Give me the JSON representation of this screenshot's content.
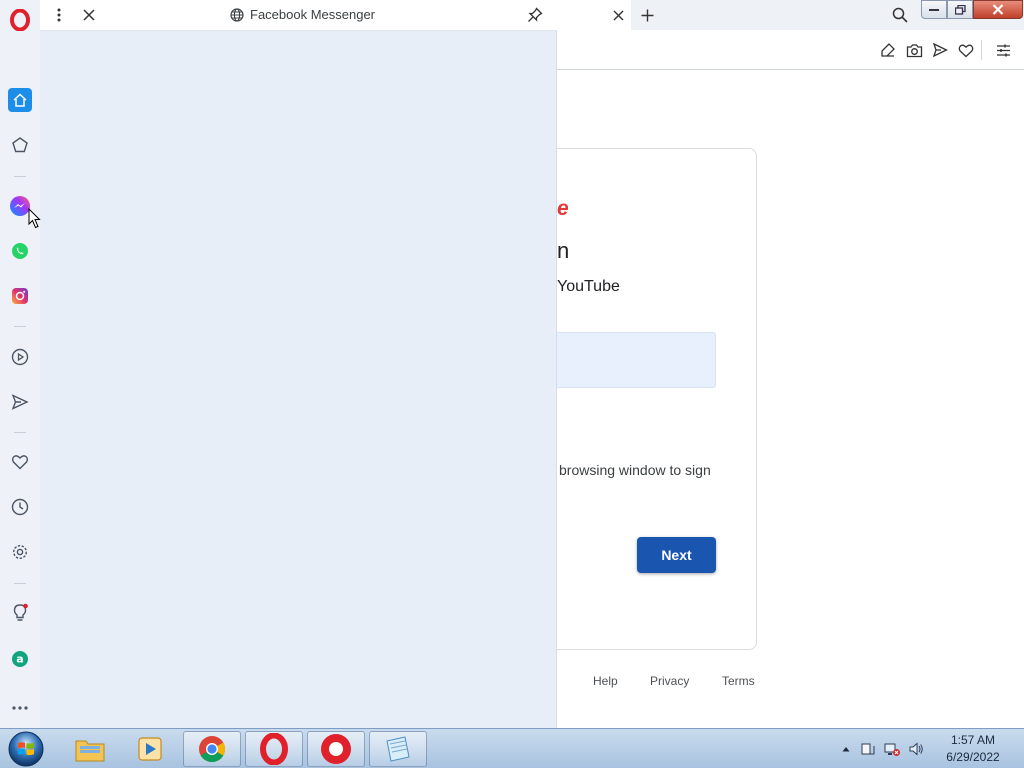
{
  "sidebar": {
    "items": [
      {
        "name": "opera-logo-icon"
      },
      {
        "name": "home-icon"
      },
      {
        "name": "speed-dial-icon"
      },
      {
        "name": "messenger-icon"
      },
      {
        "name": "whatsapp-icon"
      },
      {
        "name": "instagram-icon"
      },
      {
        "name": "player-icon"
      },
      {
        "name": "send-icon"
      },
      {
        "name": "heart-icon"
      },
      {
        "name": "history-icon"
      },
      {
        "name": "settings-icon"
      },
      {
        "name": "lightbulb-icon"
      },
      {
        "name": "aria-icon"
      },
      {
        "name": "more-icon"
      }
    ]
  },
  "panel": {
    "title": "Facebook Messenger"
  },
  "page": {
    "brand_fragment": "e",
    "heading_fragment": "n",
    "subtitle_fragment": "YouTube",
    "info_fragment": "browsing window to sign",
    "next_button": "Next",
    "footer": {
      "help": "Help",
      "privacy": "Privacy",
      "terms": "Terms"
    }
  },
  "taskbar": {
    "apps": [
      "explorer",
      "media-player",
      "chrome",
      "opera",
      "opera-gx",
      "notepad"
    ],
    "time": "1:57 AM",
    "date": "6/29/2022"
  },
  "colors": {
    "accent": "#1a56b0",
    "brand_red": "#e03a3a",
    "sidebar_bg": "#eef2f8",
    "panel_bg": "#e7eef7"
  }
}
